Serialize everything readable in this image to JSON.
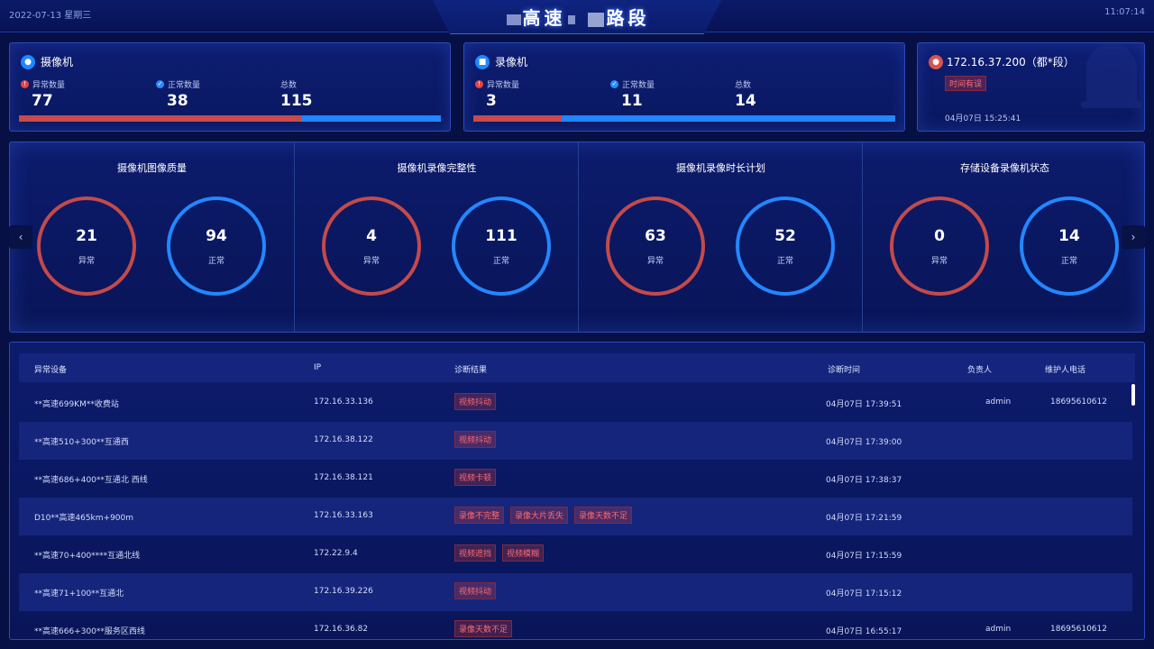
{
  "header": {
    "date": "2022-07-13 星期三",
    "title_part1": "高速",
    "title_part2": "路段",
    "time": "11:07:14"
  },
  "camera_card": {
    "title": "摄像机",
    "icon": "camera-icon",
    "stats": [
      {
        "label": "异常数量",
        "value": "77"
      },
      {
        "label": "正常数量",
        "value": "38"
      },
      {
        "label": "总数",
        "value": "115"
      }
    ],
    "abnormal_fraction": 0.67
  },
  "recorder_card": {
    "title": "录像机",
    "icon": "recorder-icon",
    "stats": [
      {
        "label": "异常数量",
        "value": "3"
      },
      {
        "label": "正常数量",
        "value": "11"
      },
      {
        "label": "总数",
        "value": "14"
      }
    ],
    "abnormal_fraction": 0.21
  },
  "alert_card": {
    "ip": "172.16.37.200（都*段）",
    "tag": "时间有误",
    "time": "04月07日 15:25:41",
    "icon": "bell-icon"
  },
  "rings": [
    {
      "title": "摄像机图像质量",
      "abnormal": "21",
      "normal": "94"
    },
    {
      "title": "摄像机录像完整性",
      "abnormal": "4",
      "normal": "111"
    },
    {
      "title": "摄像机录像时长计划",
      "abnormal": "63",
      "normal": "52"
    },
    {
      "title": "存储设备录像机状态",
      "abnormal": "0",
      "normal": "14"
    }
  ],
  "ring_labels": {
    "abnormal": "异常",
    "normal": "正常"
  },
  "colors": {
    "abnormal": "#c44a4a",
    "normal": "#2387ff",
    "background": "#061044"
  },
  "table": {
    "headers": [
      "异常设备",
      "IP",
      "诊断结果",
      "诊断时间",
      "负责人",
      "维护人电话"
    ],
    "rows": [
      {
        "device": "**高速699KM**收费站",
        "ip": "172.16.33.136",
        "results": [
          "视频抖动"
        ],
        "time": "04月07日 17:39:51",
        "owner": "admin",
        "phone": "18695610612"
      },
      {
        "device": "**高速510+300**互通西",
        "ip": "172.16.38.122",
        "results": [
          "视频抖动"
        ],
        "time": "04月07日 17:39:00",
        "owner": "",
        "phone": ""
      },
      {
        "device": "**高速686+400**互通北 西线",
        "ip": "172.16.38.121",
        "results": [
          "视频卡顿"
        ],
        "time": "04月07日 17:38:37",
        "owner": "",
        "phone": ""
      },
      {
        "device": "D10**高速465km+900m",
        "ip": "172.16.33.163",
        "results": [
          "录像不完整",
          "录像大片丢失",
          "录像天数不足"
        ],
        "time": "04月07日 17:21:59",
        "owner": "",
        "phone": ""
      },
      {
        "device": "**高速70+400****互通北线",
        "ip": "172.22.9.4",
        "results": [
          "视频遮挡",
          "视频模糊"
        ],
        "time": "04月07日 17:15:59",
        "owner": "",
        "phone": ""
      },
      {
        "device": "**高速71+100**互通北",
        "ip": "172.16.39.226",
        "results": [
          "视频抖动"
        ],
        "time": "04月07日 17:15:12",
        "owner": "",
        "phone": ""
      },
      {
        "device": "**高速666+300**服务区西线",
        "ip": "172.16.36.82",
        "results": [
          "录像天数不足"
        ],
        "time": "04月07日 16:55:17",
        "owner": "admin",
        "phone": "18695610612"
      }
    ]
  }
}
